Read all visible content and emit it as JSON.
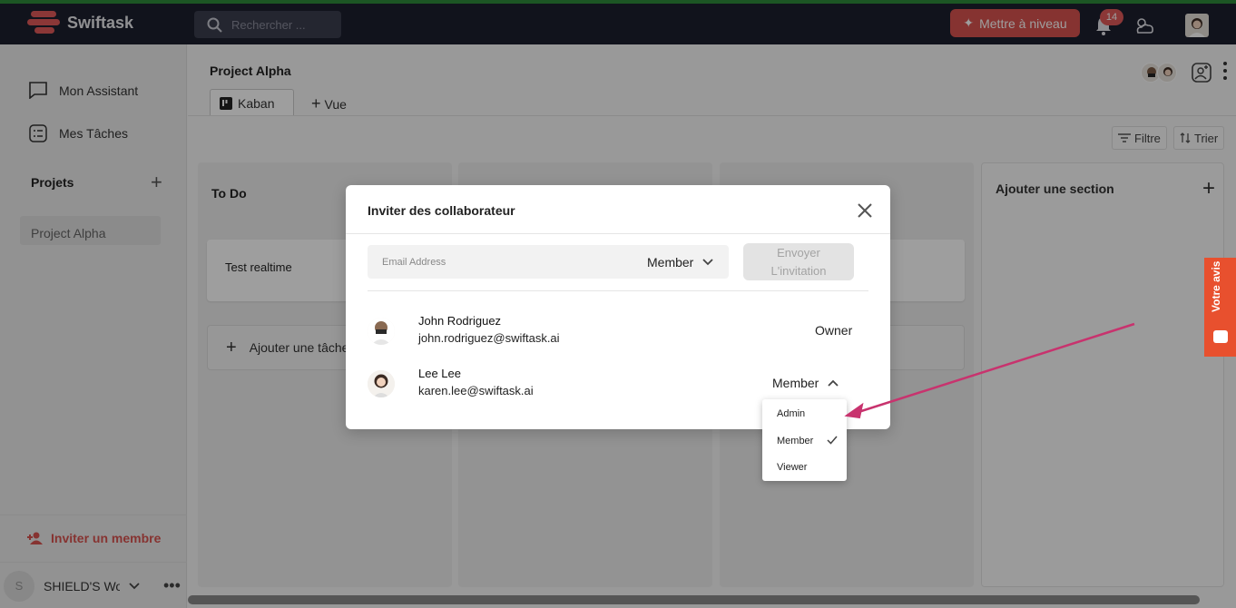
{
  "app": {
    "logo_text": "Swiftask",
    "search_placeholder": "Rechercher ...",
    "upgrade_label": "Mettre à niveau",
    "notification_count": "14",
    "colors": {
      "accent": "#d9534f",
      "topbar": "#1c1f2e",
      "feedback": "#e8502e"
    }
  },
  "sidebar": {
    "items": [
      {
        "label": "Mon Assistant",
        "icon": "chat-icon"
      },
      {
        "label": "Mes Tâches",
        "icon": "tasks-icon"
      }
    ],
    "projects_heading": "Projets",
    "projects": [
      "Project Alpha"
    ],
    "invite_label": "Inviter un membre",
    "workspace_name": "SHIELD'S Wo",
    "workspace_initial": "S"
  },
  "main": {
    "project_title": "Project Alpha",
    "tabs": [
      {
        "label": "Kaban"
      },
      {
        "label": "Vue"
      }
    ],
    "filter_label": "Filtre",
    "sort_label": "Trier",
    "columns": [
      {
        "title": "To Do",
        "cards": [
          "Test realtime"
        ],
        "add_task_label": "Ajouter une tâche"
      },
      {
        "title": "",
        "cards": []
      },
      {
        "title": "",
        "cards": []
      }
    ],
    "add_section_label": "Ajouter une section"
  },
  "feedback_label": "Votre avis",
  "modal": {
    "title": "Inviter des collaborateur",
    "email_placeholder": "Email Address",
    "role_selected": "Member",
    "send_label_line1": "Envoyer",
    "send_label_line2": "L'invitation",
    "members": [
      {
        "name": "John Rodriguez",
        "email": "john.rodriguez@swiftask.ai",
        "role": "Owner"
      },
      {
        "name": "Lee Lee",
        "email": "karen.lee@swiftask.ai",
        "role": "Member"
      }
    ],
    "role_options": [
      "Admin",
      "Member",
      "Viewer"
    ],
    "role_options_selected": "Member"
  }
}
